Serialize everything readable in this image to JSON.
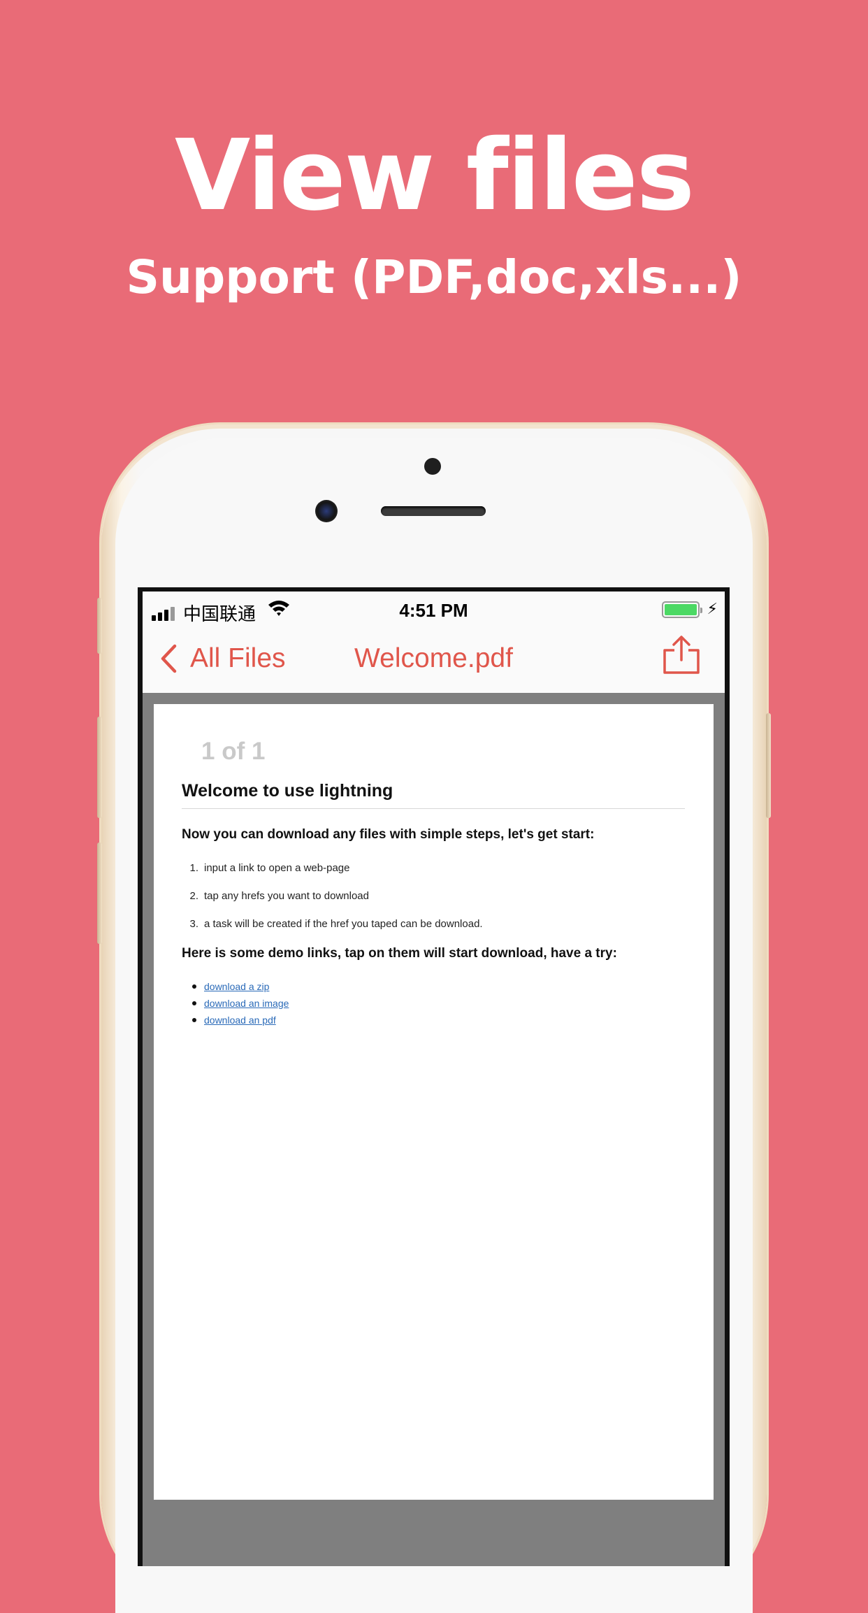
{
  "promo": {
    "headline": "View files",
    "subline": "Support (PDF,doc,xls...)",
    "background_color": "#e96b77"
  },
  "status_bar": {
    "carrier": "中国联通",
    "time": "4:51 PM",
    "battery_color": "#4cd964"
  },
  "nav": {
    "back_label": "All Files",
    "title": "Welcome.pdf",
    "accent_color": "#e0564b",
    "icons": [
      "chevron-left-icon",
      "share-icon"
    ]
  },
  "document": {
    "page_indicator": "1 of 1",
    "title": "Welcome to use lightning",
    "intro": "Now you can download any files with simple steps, let's get start:",
    "steps": [
      {
        "num": "1.",
        "text": "input a link to open a web-page"
      },
      {
        "num": "2.",
        "text": "tap any hrefs you want to download"
      },
      {
        "num": "3.",
        "text": "a task will be created if the href you taped can be download."
      }
    ],
    "demo_heading": "Here is some demo links, tap on them will start download, have a try:",
    "links": [
      {
        "text": "download a zip"
      },
      {
        "text": "download an image"
      },
      {
        "text": "download an pdf"
      }
    ]
  }
}
